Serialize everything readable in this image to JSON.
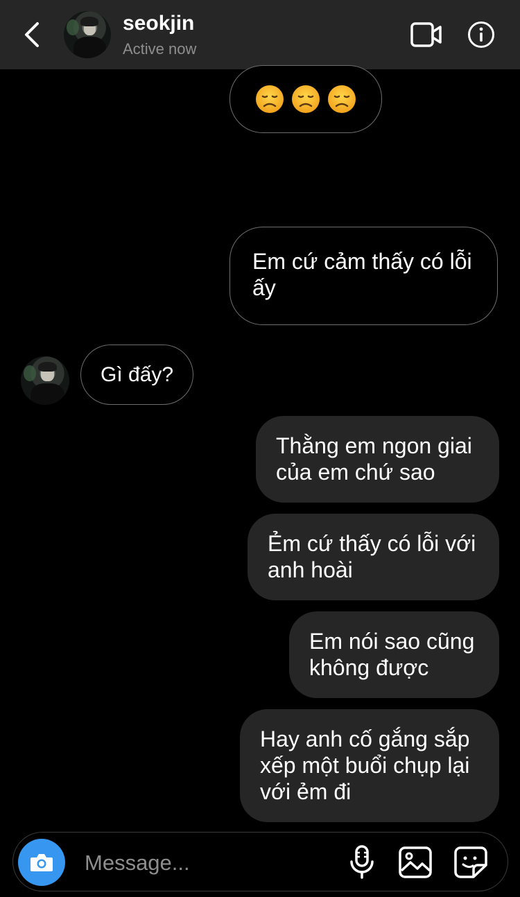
{
  "header": {
    "title": "seokjin",
    "status": "Active now",
    "icons": {
      "back": "chevron-left-icon",
      "video": "video-camera-icon",
      "info": "info-icon"
    }
  },
  "messages": [
    {
      "id": "emoji",
      "text": "😞😞😞",
      "direction": "sent",
      "style": "outlined"
    },
    {
      "id": "m1",
      "text": "Em cứ cảm thấy có lỗi ấy",
      "direction": "sent",
      "style": "outlined"
    },
    {
      "id": "m2",
      "text": "Gì đấy?",
      "direction": "received",
      "style": "outlined"
    },
    {
      "id": "m3",
      "text": "Thằng em ngon giai của em chứ sao",
      "direction": "sent",
      "style": "filled"
    },
    {
      "id": "m4",
      "text": "Ẻm cứ thấy có lỗi với anh hoài",
      "direction": "sent",
      "style": "filled"
    },
    {
      "id": "m5",
      "text": "Em nói sao cũng không được",
      "direction": "sent",
      "style": "filled"
    },
    {
      "id": "m6",
      "text": "Hay anh cố gắng sắp xếp một buổi chụp lại với ẻm đi",
      "direction": "sent",
      "style": "filled"
    }
  ],
  "composer": {
    "placeholder": "Message...",
    "icons": {
      "camera": "camera-icon",
      "mic": "microphone-icon",
      "gallery": "image-icon",
      "sticker": "sticker-icon"
    }
  },
  "colors": {
    "background": "#000000",
    "header": "#262626",
    "bubble_filled": "#262626",
    "bubble_outline": "#6e6e6e",
    "accent": "#3797f0",
    "secondary_text": "#8e8e8e"
  }
}
